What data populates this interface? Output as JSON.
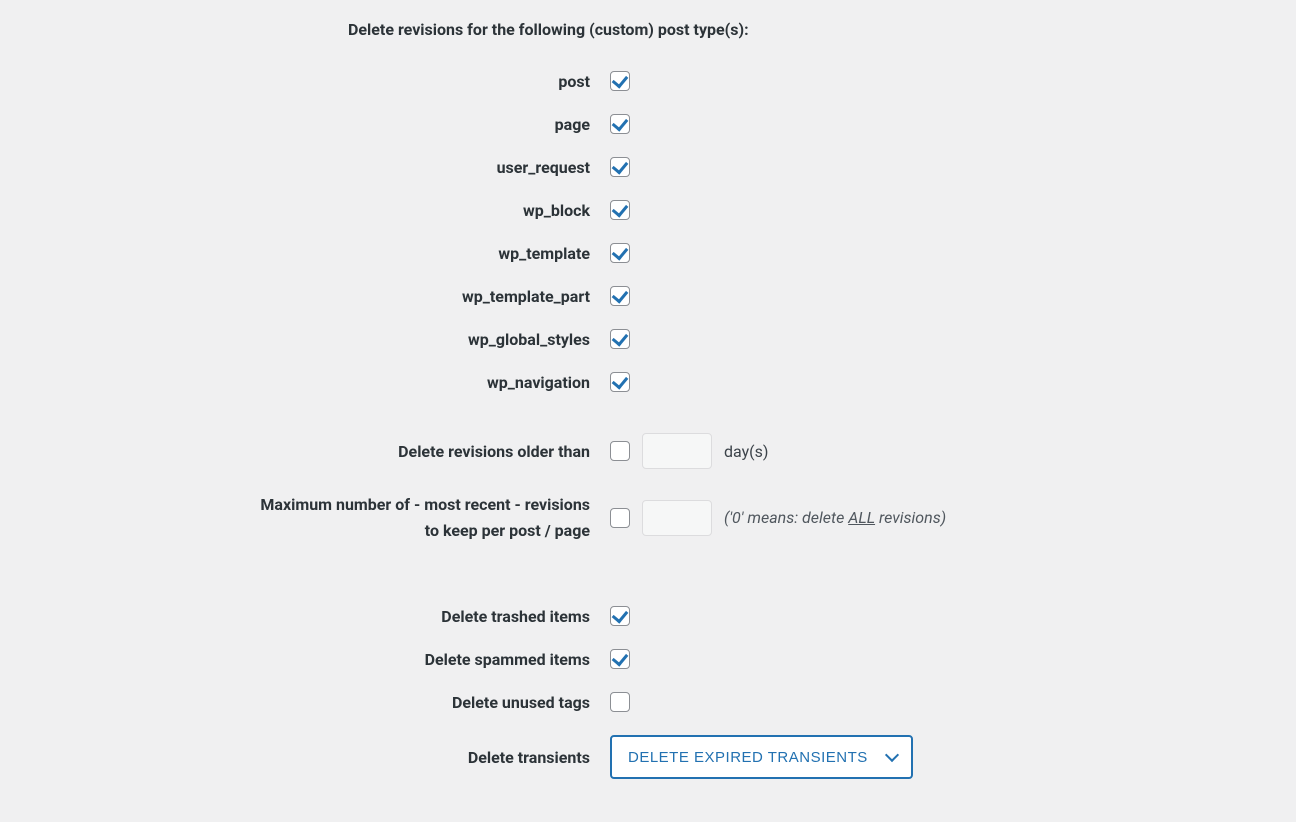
{
  "header": {
    "title": "Delete revisions for the following (custom) post type(s):"
  },
  "post_types": [
    {
      "label": "post",
      "checked": true
    },
    {
      "label": "page",
      "checked": true
    },
    {
      "label": "user_request",
      "checked": true
    },
    {
      "label": "wp_block",
      "checked": true
    },
    {
      "label": "wp_template",
      "checked": true
    },
    {
      "label": "wp_template_part",
      "checked": true
    },
    {
      "label": "wp_global_styles",
      "checked": true
    },
    {
      "label": "wp_navigation",
      "checked": true
    }
  ],
  "revisions_older": {
    "label": "Delete revisions older than",
    "checked": false,
    "value": "",
    "unit": "day(s)"
  },
  "max_revisions": {
    "label_line1": "Maximum number of - most recent - revisions",
    "label_line2": "to keep per post / page",
    "checked": false,
    "value": "",
    "hint_prefix": "('0' means: delete ",
    "hint_underline": "ALL",
    "hint_suffix": " revisions)"
  },
  "trashed": {
    "label": "Delete trashed items",
    "checked": true
  },
  "spammed": {
    "label": "Delete spammed items",
    "checked": true
  },
  "unused_tags": {
    "label": "Delete unused tags",
    "checked": false
  },
  "transients": {
    "label": "Delete transients",
    "selected": "DELETE EXPIRED TRANSIENTS"
  }
}
